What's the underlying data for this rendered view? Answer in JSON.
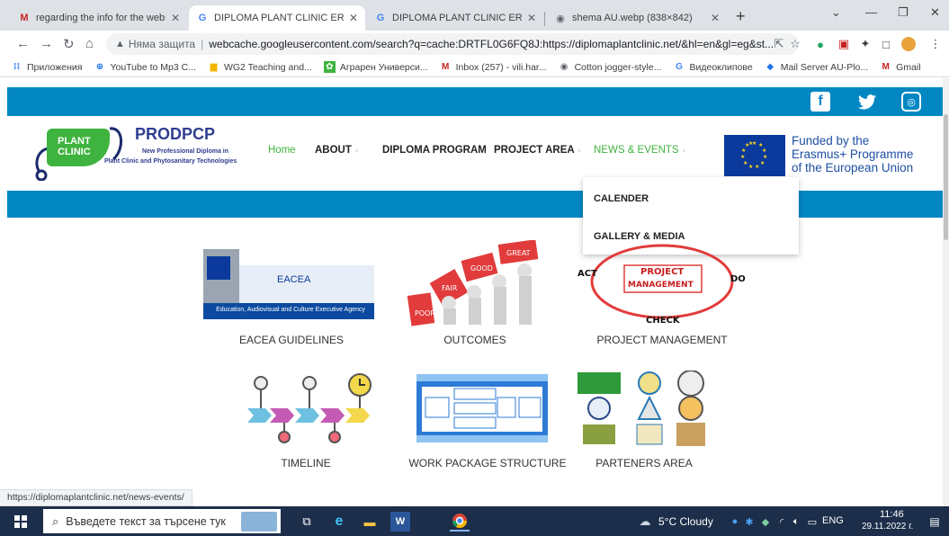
{
  "tabs": [
    {
      "title": "regarding the info for the websit",
      "icon": "gmail-icon"
    },
    {
      "title": "DIPLOMA PLANT CLINIC ERASM",
      "icon": "google-icon"
    },
    {
      "title": "DIPLOMA PLANT CLINIC ERASM",
      "icon": "google-icon"
    },
    {
      "title": "shema AU.webp (838×842)",
      "icon": "globe-icon"
    }
  ],
  "address": {
    "security": "Няма защита",
    "url": "webcache.googleusercontent.com/search?q=cache:DRTFL0G6FQ8J:https://diplomaplantclinic.net/&hl=en&gl=eg&st..."
  },
  "bookmarks": [
    "Приложения",
    "YouTube to Mp3 C...",
    "WG2 Teaching and...",
    "Аграрен Универси...",
    "Inbox (257) - vili.har...",
    "Cotton jogger-style...",
    "Видеоклипове",
    "Mail Server AU-Plo...",
    "Gmail"
  ],
  "site": {
    "logo": {
      "line1": "PLANT",
      "line2": "CLINIC",
      "brand": "PRODPCP",
      "tag1": "New Professional Diploma in",
      "tag2": "Plant Clinic and Phytosanitary Technologies"
    },
    "nav": {
      "home": "Home",
      "about": "ABOUT",
      "diploma": "DIPLOMA PROGRAM",
      "project": "PROJECT AREA",
      "news": "NEWS & EVENTS"
    },
    "funded": [
      "Funded by the",
      "Erasmus+ Programme",
      "of the European Union"
    ],
    "dropdown": [
      "CALENDER",
      "GALLERY & MEDIA"
    ],
    "cards": [
      {
        "caption": "EACEA GUIDELINES",
        "img_title": "EACEA",
        "img_sub": "Education, Audiovisual and Culture Executive Agency"
      },
      {
        "caption": "OUTCOMES",
        "img_words": [
          "POOR",
          "FAIR",
          "GOOD",
          "GREAT"
        ]
      },
      {
        "caption": "PROJECT MANAGEMENT",
        "img_words": [
          "PROJECT",
          "MANAGEMENT",
          "ACT",
          "DO",
          "CHECK"
        ]
      },
      {
        "caption": "TIMELINE"
      },
      {
        "caption": "WORK PACKAGE STRUCTURE"
      },
      {
        "caption": "PARTENERS AREA"
      }
    ]
  },
  "status_url": "https://diplomaplantclinic.net/news-events/",
  "taskbar": {
    "search_placeholder": "Въведете текст за търсене тук",
    "weather": "5°C  Cloudy",
    "lang": "ENG",
    "time": "11:46",
    "date": "29.11.2022 г."
  },
  "colors": {
    "brand_blue": "#0287c3",
    "brand_green": "#3fb33f",
    "taskbar": "#1c2e4a"
  }
}
